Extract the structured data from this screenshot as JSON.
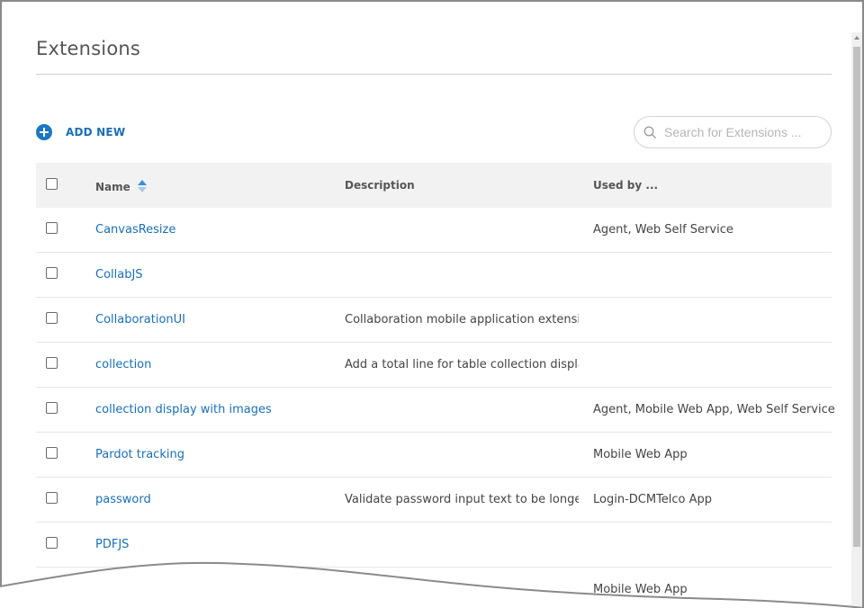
{
  "page": {
    "title": "Extensions"
  },
  "toolbar": {
    "add_new_label": "ADD NEW"
  },
  "search": {
    "placeholder": "Search for Extensions ..."
  },
  "table": {
    "columns": {
      "name": "Name",
      "description": "Description",
      "used_by": "Used by ..."
    },
    "rows": [
      {
        "name": "CanvasResize",
        "description": "",
        "used_by": "Agent, Web Self Service"
      },
      {
        "name": "CollabJS",
        "description": "",
        "used_by": ""
      },
      {
        "name": "CollaborationUI",
        "description": "Collaboration mobile application extensi...",
        "used_by": ""
      },
      {
        "name": "collection",
        "description": "Add a total line for table collection display",
        "used_by": ""
      },
      {
        "name": "collection display with images",
        "description": "",
        "used_by": "Agent, Mobile Web App, Web Self Service"
      },
      {
        "name": "Pardot tracking",
        "description": "",
        "used_by": "Mobile Web App"
      },
      {
        "name": "password",
        "description": "Validate password input text to be longe...",
        "used_by": "Login-DCMTelco App"
      },
      {
        "name": "PDFJS",
        "description": "",
        "used_by": ""
      },
      {
        "name": "",
        "description": "",
        "used_by": "Mobile Web App"
      }
    ]
  },
  "colors": {
    "accent": "#1a6fb5",
    "header_bg": "#f2f2f2"
  }
}
